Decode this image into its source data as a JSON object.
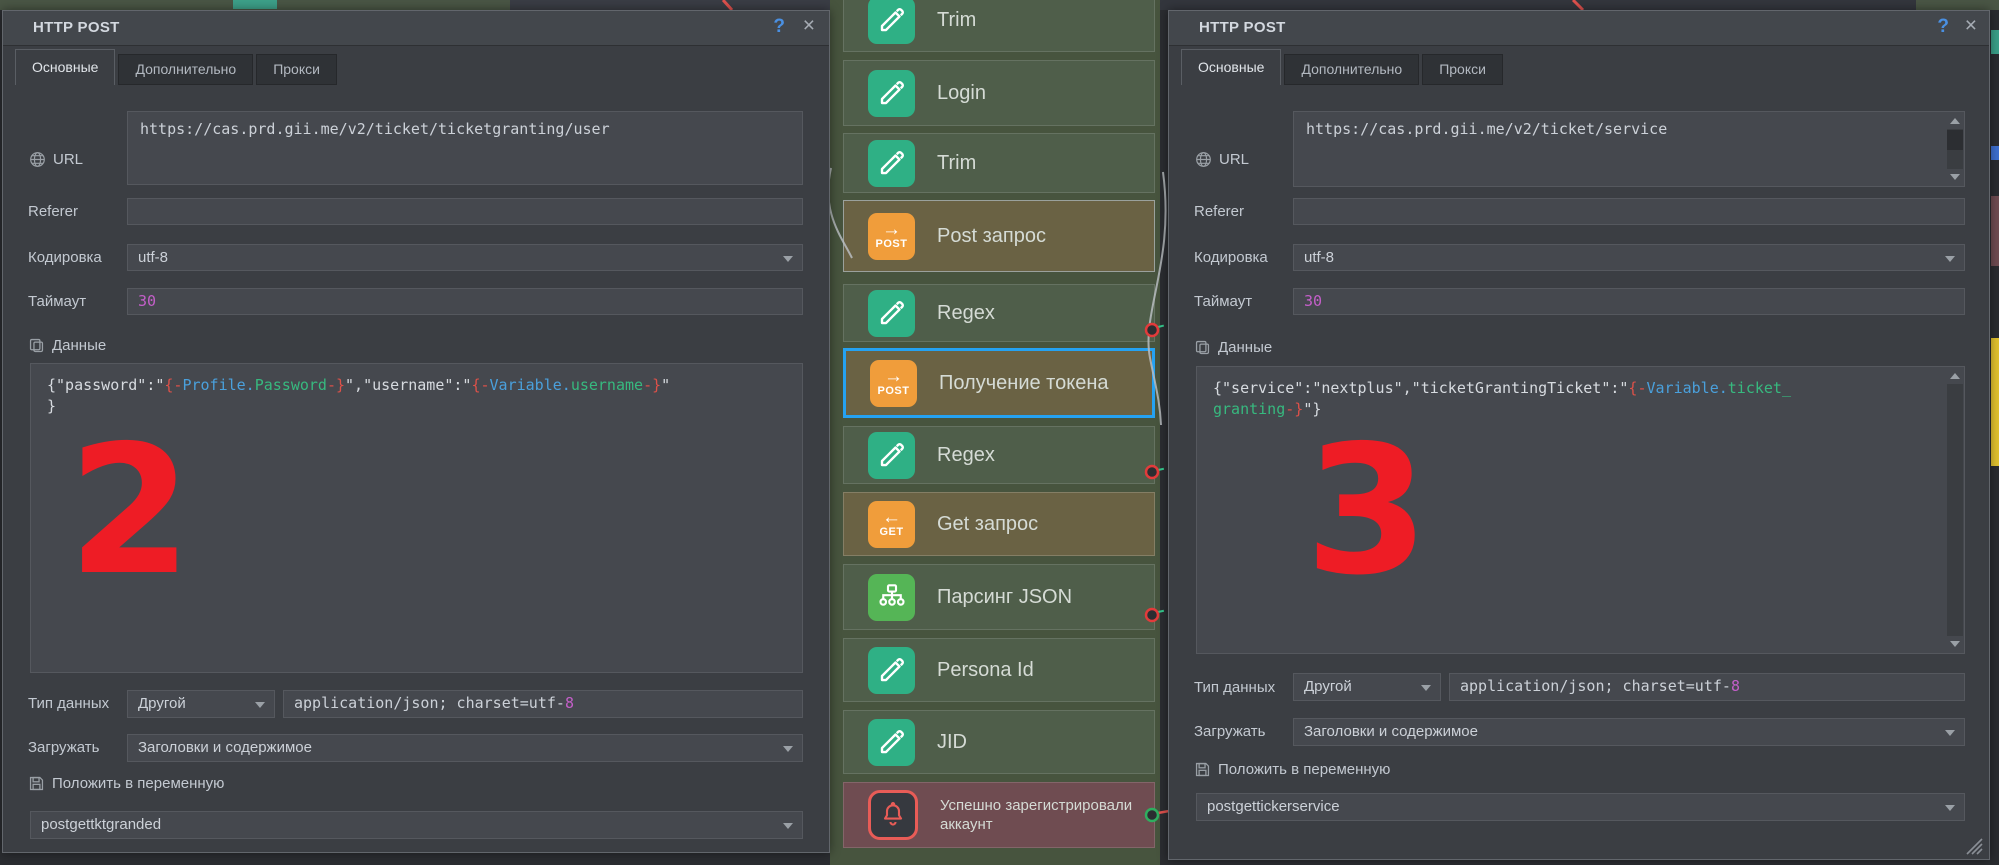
{
  "dialog_left": {
    "title": "HTTP POST",
    "help_icon": "?",
    "close_icon": "×",
    "tabs": [
      {
        "label": "Основные",
        "active": true
      },
      {
        "label": "Дополнительно",
        "active": false
      },
      {
        "label": "Прокси",
        "active": false
      }
    ],
    "url": {
      "label": "URL",
      "value": "https://cas.prd.gii.me/v2/ticket/ticketgranting/user"
    },
    "referer": {
      "label": "Referer",
      "value": ""
    },
    "encoding": {
      "label": "Кодировка",
      "value": "utf-8"
    },
    "timeout": {
      "label": "Таймаут",
      "value": "30"
    },
    "data_section": {
      "label": "Данные",
      "code": [
        [
          {
            "t": "{\"password\":\"",
            "c": "p"
          },
          {
            "t": "{-",
            "c": "r"
          },
          {
            "t": "Profile.",
            "c": "b"
          },
          {
            "t": "Password",
            "c": "g"
          },
          {
            "t": "-}",
            "c": "r"
          },
          {
            "t": "\",\"username\":\"",
            "c": "p"
          },
          {
            "t": "{-",
            "c": "r"
          },
          {
            "t": "Variable.",
            "c": "b"
          },
          {
            "t": "username",
            "c": "g"
          },
          {
            "t": "-}",
            "c": "r"
          },
          {
            "t": "\"",
            "c": "p"
          }
        ],
        [
          {
            "t": "}",
            "c": "p"
          }
        ]
      ]
    },
    "datatype": {
      "label": "Тип данных",
      "value": "Другой",
      "content_type": "application/json; charset=utf-",
      "content_type_hl": "8"
    },
    "load": {
      "label": "Загружать",
      "value": "Заголовки и содержимое"
    },
    "put": {
      "label": "Положить в переменную",
      "value": "postgettktgranded"
    },
    "marker": "2"
  },
  "dialog_right": {
    "title": "HTTP POST",
    "help_icon": "?",
    "close_icon": "×",
    "tabs": [
      {
        "label": "Основные",
        "active": true
      },
      {
        "label": "Дополнительно",
        "active": false
      },
      {
        "label": "Прокси",
        "active": false
      }
    ],
    "url": {
      "label": "URL",
      "value": "https://cas.prd.gii.me/v2/ticket/service"
    },
    "referer": {
      "label": "Referer",
      "value": ""
    },
    "encoding": {
      "label": "Кодировка",
      "value": "utf-8"
    },
    "timeout": {
      "label": "Таймаут",
      "value": "30"
    },
    "data_section": {
      "label": "Данные",
      "code": [
        [
          {
            "t": "{\"service\":\"nextplus\",\"ticketGrantingTicket\":\"",
            "c": "p"
          },
          {
            "t": "{-",
            "c": "r"
          },
          {
            "t": "Variable.",
            "c": "b"
          },
          {
            "t": "ticket_",
            "c": "g"
          }
        ],
        [
          {
            "t": "granting",
            "c": "g"
          },
          {
            "t": "-}",
            "c": "r"
          },
          {
            "t": "\"}",
            "c": "p"
          }
        ]
      ]
    },
    "datatype": {
      "label": "Тип данных",
      "value": "Другой",
      "content_type": "application/json; charset=utf-",
      "content_type_hl": "8"
    },
    "load": {
      "label": "Загружать",
      "value": "Заголовки и содержимое"
    },
    "put": {
      "label": "Положить в переменную",
      "value": "postgettickerservice"
    },
    "marker": "3"
  },
  "flow": {
    "rows": [
      {
        "label": "Trim",
        "icon": "pencil",
        "style": "normal"
      },
      {
        "label": "Login",
        "icon": "pencil",
        "style": "normal"
      },
      {
        "label": "Trim",
        "icon": "pencil",
        "style": "normal"
      },
      {
        "label": "Post запрос",
        "icon": "post",
        "icon_text": "POST",
        "style": "selected"
      },
      {
        "label": "Regex",
        "icon": "pencil",
        "style": "normal"
      },
      {
        "label": "Получение токена",
        "icon": "post",
        "icon_text": "POST",
        "style": "active"
      },
      {
        "label": "Regex",
        "icon": "pencil",
        "style": "normal"
      },
      {
        "label": "Get запрос",
        "icon": "get",
        "icon_text": "GET",
        "style": "olive"
      },
      {
        "label": "Парсинг JSON",
        "icon": "json",
        "style": "normal"
      },
      {
        "label": "Persona Id",
        "icon": "pencil",
        "style": "normal"
      },
      {
        "label": "JID",
        "icon": "pencil",
        "style": "normal"
      },
      {
        "label": "Успешно зарегистрировали аккаунт",
        "icon": "bell",
        "style": "alert"
      }
    ]
  },
  "colors": {
    "selection_blue": "#25a2f2",
    "post_orange": "#f09d3b",
    "pencil_teal": "#2fb085",
    "json_green": "#55b556",
    "alert_red": "#e85c57",
    "marker_red": "#ee1c25",
    "wire_green": "#35c98e",
    "wire_red": "#e0524e"
  }
}
